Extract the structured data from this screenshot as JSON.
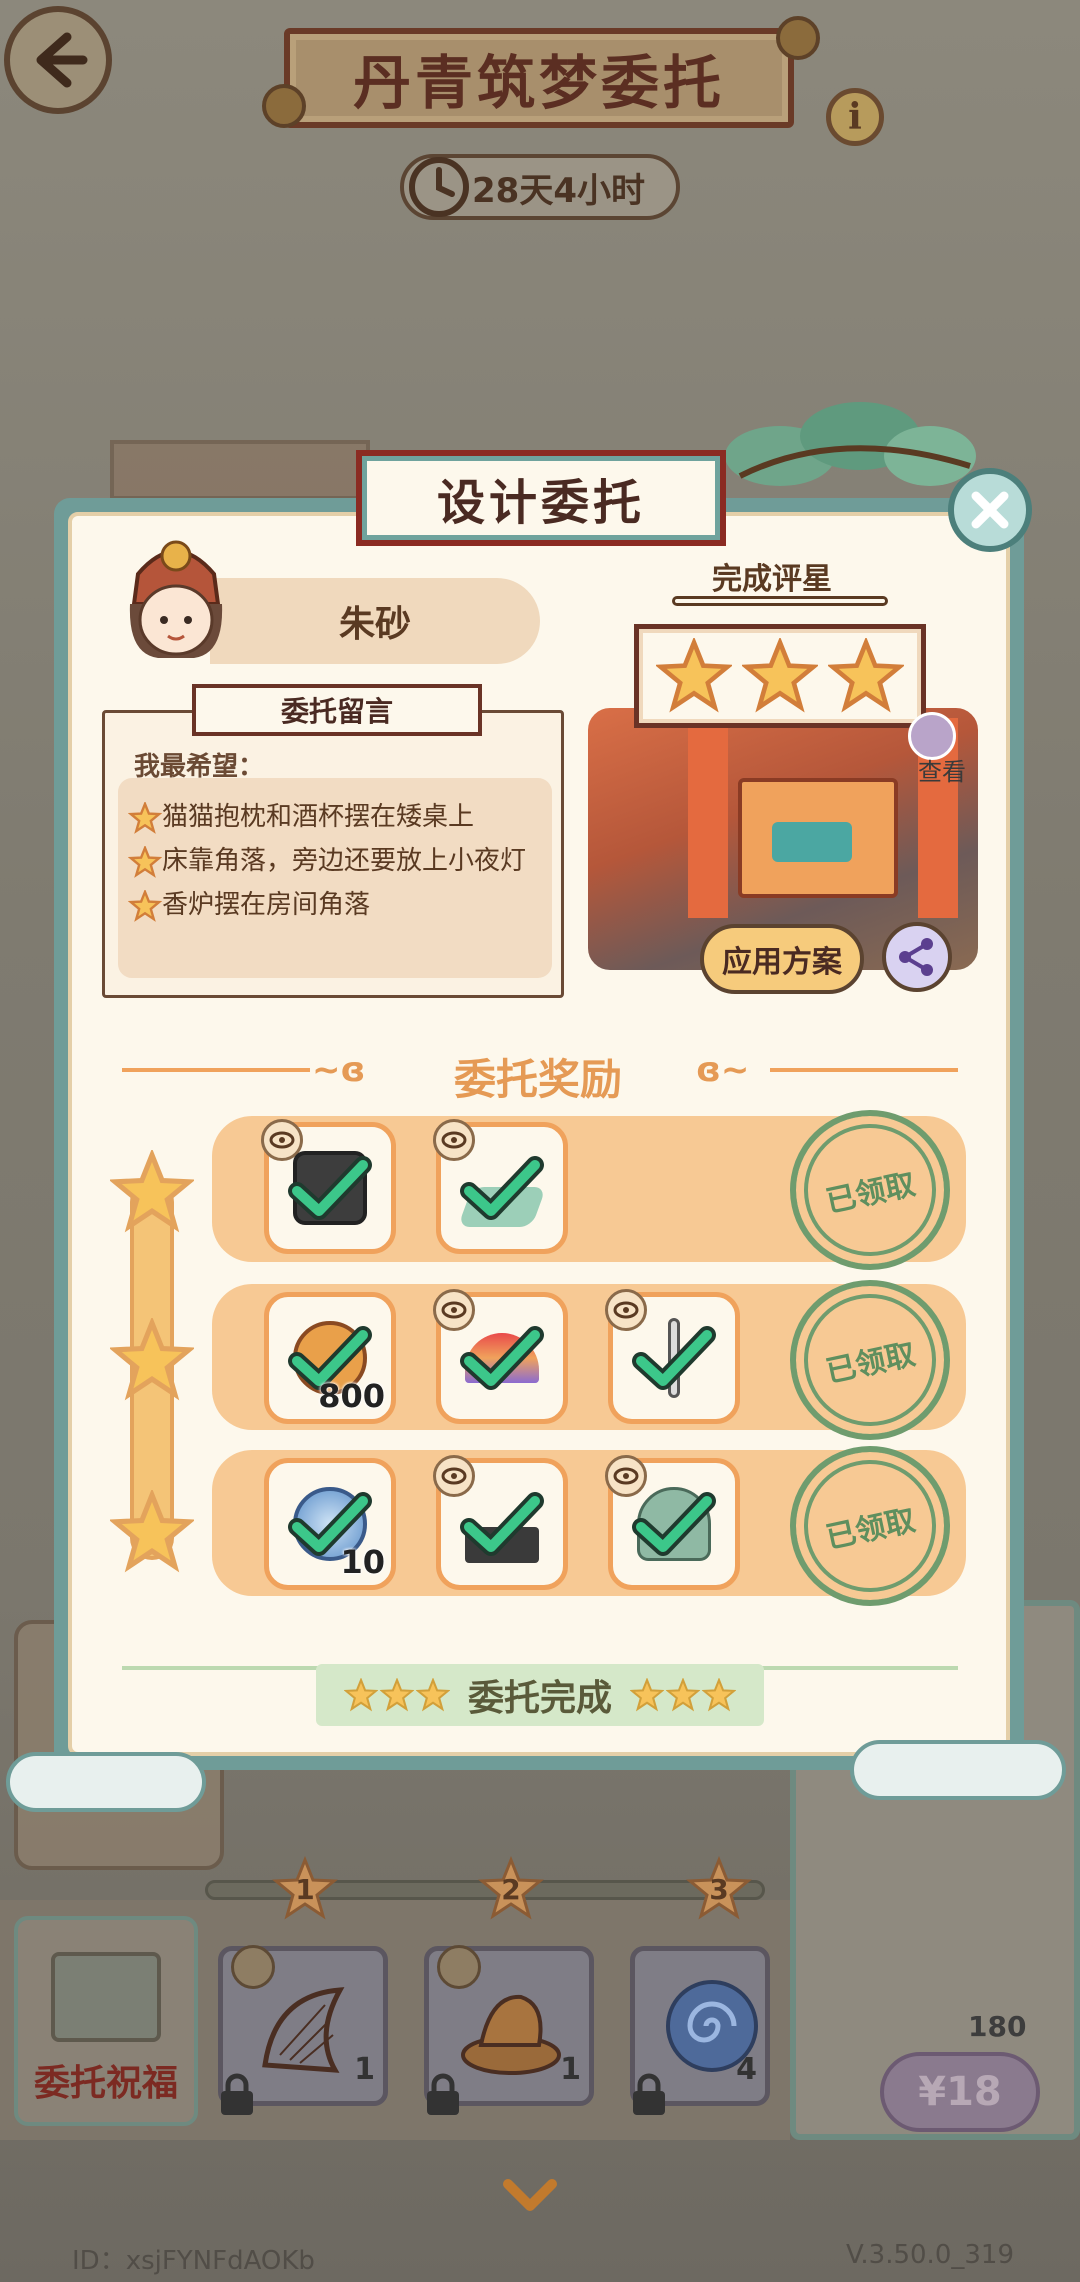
{
  "header": {
    "back_icon": "arrow-left-icon",
    "title": "丹青筑梦委托",
    "info_label": "i",
    "timer": "28天4小时"
  },
  "modal": {
    "title": "设计委托",
    "close_icon": "close-icon",
    "client_name": "朱砂",
    "message_tag": "委托留言",
    "hope_label": "我最希望：",
    "wishes": [
      "猫猫抱枕和酒杯摆在矮桌上",
      "床靠角落，旁边还要放上小夜灯",
      "香炉摆在房间角落"
    ],
    "rating_label": "完成评星",
    "rating_stars": 3,
    "view_label": "查看",
    "apply_label": "应用方案",
    "rewards_title": "委托奖励",
    "reward_rows": [
      {
        "items": [
          {
            "name": "black-box",
            "qty": "",
            "eye": true
          },
          {
            "name": "green-mat",
            "qty": "",
            "eye": true
          }
        ],
        "status": "已领取"
      },
      {
        "items": [
          {
            "name": "coin",
            "qty": "800",
            "eye": false
          },
          {
            "name": "rainbow-fan",
            "qty": "",
            "eye": true
          },
          {
            "name": "lamp-stand",
            "qty": "",
            "eye": true
          }
        ],
        "status": "已领取"
      },
      {
        "items": [
          {
            "name": "blue-orb",
            "qty": "10",
            "eye": false
          },
          {
            "name": "low-table",
            "qty": "",
            "eye": true
          },
          {
            "name": "incense-burner",
            "qty": "",
            "eye": true
          }
        ],
        "status": "已领取"
      }
    ],
    "complete_label": "委托完成"
  },
  "bottom": {
    "milestones": [
      "1",
      "2",
      "3"
    ],
    "blessing_label": "委托祝福",
    "slots": [
      {
        "icon": "harp-icon",
        "count": "1"
      },
      {
        "icon": "lotus-icon",
        "count": "1"
      },
      {
        "icon": "swirl-icon",
        "count": "4"
      }
    ],
    "price_count": "180",
    "price_label": "¥18",
    "chevron_icon": "chevron-down-icon"
  },
  "footer": {
    "id": "ID：xsjFYNFdAOKb",
    "version": "V.3.50.0_319"
  },
  "colors": {
    "accent_orange": "#f0a25c",
    "teal_frame": "#6f9c98",
    "stamp_green": "#6f9c6e",
    "check_green": "#3cc78a",
    "dark_red": "#8b2b22"
  }
}
